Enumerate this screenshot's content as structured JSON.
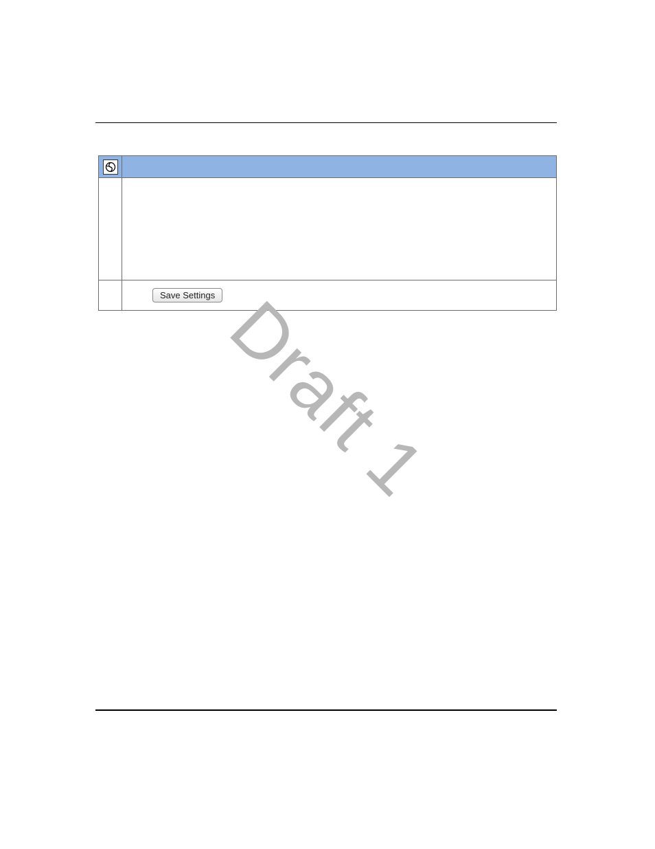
{
  "panel": {
    "header_title": "",
    "save_button_label": "Save Settings"
  },
  "watermark": "Draft 1"
}
